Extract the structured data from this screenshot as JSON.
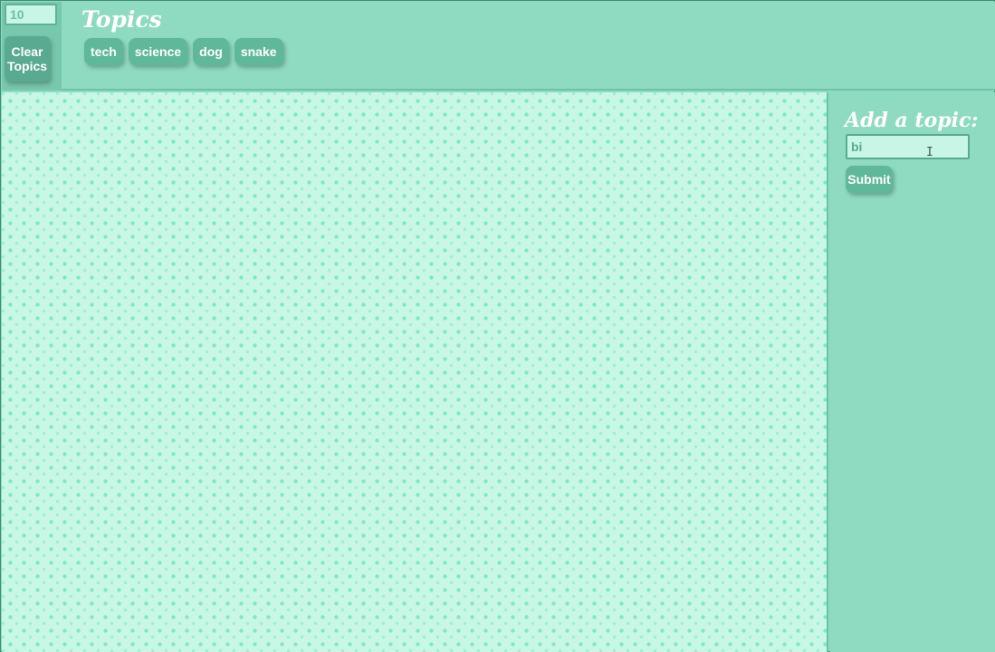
{
  "header": {
    "limit_value": "10",
    "clear_label": "Clear Topics",
    "title": "Topics"
  },
  "topics": [
    {
      "label": "tech"
    },
    {
      "label": "science"
    },
    {
      "label": "dog"
    },
    {
      "label": "snake"
    }
  ],
  "side_panel": {
    "title": "Add a topic:",
    "input_value": "bi",
    "submit_label": "Submit"
  },
  "icons": {
    "text_cursor": "text-cursor-icon"
  },
  "colors": {
    "background": "#8fdbc2",
    "button": "#5fb89a",
    "gif_area": "#c9f7e6",
    "dots": "#7ee9c6"
  }
}
